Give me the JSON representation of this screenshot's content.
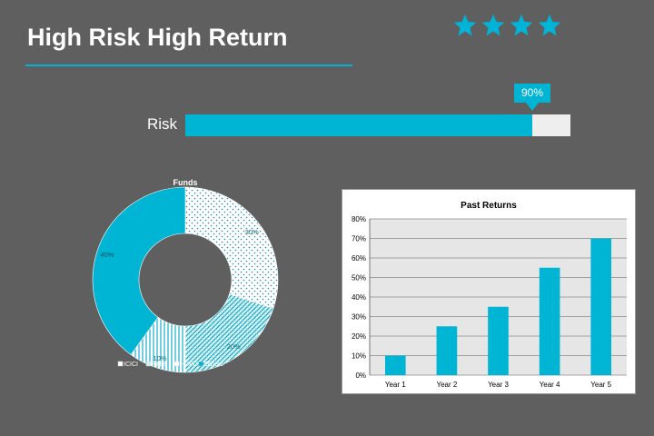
{
  "slide": {
    "title": "High Risk High Return",
    "rating": {
      "stars": 4,
      "color": "#00b4d8"
    },
    "risk": {
      "label": "Risk",
      "value_percent": 90,
      "value_label": "90%"
    }
  },
  "colors": {
    "accent": "#00b4d4",
    "track": "#eeeeee",
    "background": "#5f5f5f"
  },
  "chart_data": [
    {
      "type": "pie",
      "variant": "donut",
      "title": "Funds",
      "categories": [
        "ICICI",
        "Reliance",
        "HDFC",
        "Others"
      ],
      "legend_labels": [
        "ICICI",
        "Relia",
        "HDFC",
        "Others"
      ],
      "values": [
        30,
        20,
        10,
        40
      ],
      "data_labels": [
        "30%",
        "20%",
        "10%",
        "40%"
      ],
      "legend_position": "bottom"
    },
    {
      "type": "bar",
      "title": "Past Returns",
      "categories": [
        "Year 1",
        "Year 2",
        "Year 3",
        "Year 4",
        "Year 5"
      ],
      "values": [
        10,
        25,
        35,
        55,
        70
      ],
      "y_ticks": [
        "0%",
        "10%",
        "20%",
        "30%",
        "40%",
        "50%",
        "60%",
        "70%",
        "80%"
      ],
      "ylim": [
        0,
        80
      ],
      "y_unit": "%",
      "grid": true,
      "color": "#00b4d4"
    }
  ]
}
